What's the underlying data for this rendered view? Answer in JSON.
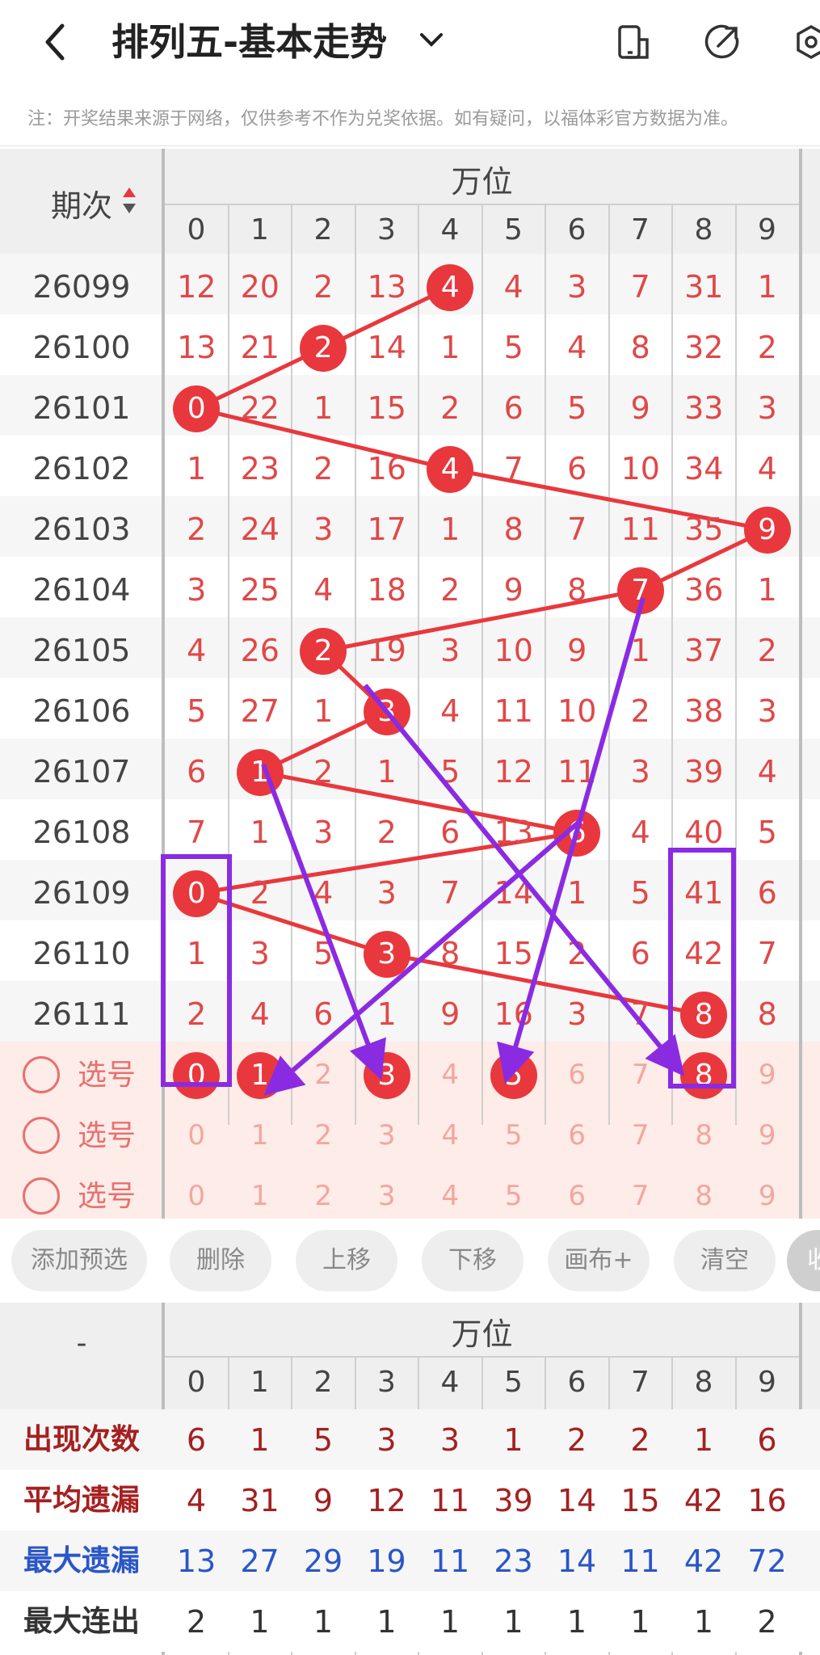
{
  "header": {
    "title": "排列五-基本走势",
    "back_icon": "chevron-left-icon",
    "dropdown_icon": "chevron-down-icon",
    "buttons": [
      "phone-layout-icon",
      "share-icon",
      "settings-icon"
    ]
  },
  "notice": "注：开奖结果来源于网络，仅供参考不作为兑奖依据。如有疑问，以福体彩官方数据为准。",
  "grid": {
    "period_header": "期次",
    "position_header": "万位",
    "digits": [
      "0",
      "1",
      "2",
      "3",
      "4",
      "5",
      "6",
      "7",
      "8",
      "9"
    ],
    "rows": [
      {
        "period": "26099",
        "values": [
          "12",
          "20",
          "2",
          "13",
          "4",
          "4",
          "3",
          "7",
          "31",
          "1"
        ],
        "hit": 4
      },
      {
        "period": "26100",
        "values": [
          "13",
          "21",
          "2",
          "14",
          "1",
          "5",
          "4",
          "8",
          "32",
          "2"
        ],
        "hit": 2
      },
      {
        "period": "26101",
        "values": [
          "0",
          "22",
          "1",
          "15",
          "2",
          "6",
          "5",
          "9",
          "33",
          "3"
        ],
        "hit": 0
      },
      {
        "period": "26102",
        "values": [
          "1",
          "23",
          "2",
          "16",
          "4",
          "7",
          "6",
          "10",
          "34",
          "4"
        ],
        "hit": 4
      },
      {
        "period": "26103",
        "values": [
          "2",
          "24",
          "3",
          "17",
          "1",
          "8",
          "7",
          "11",
          "35",
          "9"
        ],
        "hit": 9
      },
      {
        "period": "26104",
        "values": [
          "3",
          "25",
          "4",
          "18",
          "2",
          "9",
          "8",
          "7",
          "36",
          "1"
        ],
        "hit": 7
      },
      {
        "period": "26105",
        "values": [
          "4",
          "26",
          "2",
          "19",
          "3",
          "10",
          "9",
          "1",
          "37",
          "2"
        ],
        "hit": 2
      },
      {
        "period": "26106",
        "values": [
          "5",
          "27",
          "1",
          "3",
          "4",
          "11",
          "10",
          "2",
          "38",
          "3"
        ],
        "hit": 3
      },
      {
        "period": "26107",
        "values": [
          "6",
          "1",
          "2",
          "1",
          "5",
          "12",
          "11",
          "3",
          "39",
          "4"
        ],
        "hit": 1
      },
      {
        "period": "26108",
        "values": [
          "7",
          "1",
          "3",
          "2",
          "6",
          "13",
          "6",
          "4",
          "40",
          "5"
        ],
        "hit": 6
      },
      {
        "period": "26109",
        "values": [
          "0",
          "2",
          "4",
          "3",
          "7",
          "14",
          "1",
          "5",
          "41",
          "6"
        ],
        "hit": 0
      },
      {
        "period": "26110",
        "values": [
          "1",
          "3",
          "5",
          "3",
          "8",
          "15",
          "2",
          "6",
          "42",
          "7"
        ],
        "hit": 3
      },
      {
        "period": "26111",
        "values": [
          "2",
          "4",
          "6",
          "1",
          "9",
          "16",
          "3",
          "7",
          "8",
          "8"
        ],
        "hit": 8
      }
    ],
    "pick_label": "选号",
    "pick_rows": [
      {
        "selected": [
          0,
          1,
          3,
          5,
          8
        ]
      },
      {
        "selected": []
      },
      {
        "selected": []
      }
    ]
  },
  "toolbar": [
    "添加预选",
    "删除",
    "上移",
    "下移",
    "画布+",
    "清空",
    "收"
  ],
  "stats": {
    "corner": "-",
    "position_header": "万位",
    "digits": [
      "0",
      "1",
      "2",
      "3",
      "4",
      "5",
      "6",
      "7",
      "8",
      "9"
    ],
    "rows": [
      {
        "label": "出现次数",
        "color": "#a52020",
        "values": [
          "6",
          "1",
          "5",
          "3",
          "3",
          "1",
          "2",
          "2",
          "1",
          "6"
        ]
      },
      {
        "label": "平均遗漏",
        "color": "#a52020",
        "values": [
          "4",
          "31",
          "9",
          "12",
          "11",
          "39",
          "14",
          "15",
          "42",
          "16"
        ]
      },
      {
        "label": "最大遗漏",
        "color": "#2a56c6",
        "values": [
          "13",
          "27",
          "29",
          "19",
          "11",
          "23",
          "14",
          "11",
          "42",
          "72"
        ]
      },
      {
        "label": "最大连出",
        "color": "#333333",
        "values": [
          "2",
          "1",
          "1",
          "1",
          "1",
          "1",
          "1",
          "1",
          "1",
          "2"
        ]
      }
    ]
  }
}
